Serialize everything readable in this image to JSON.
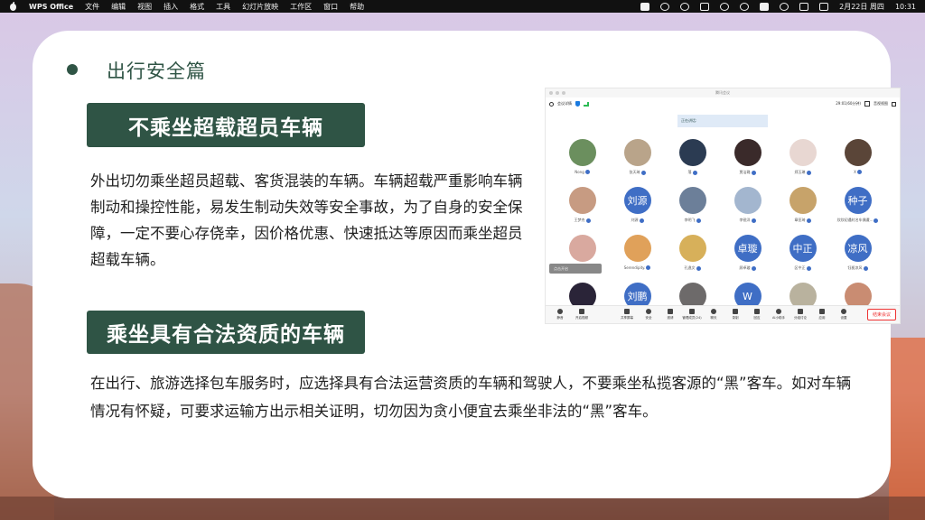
{
  "menubar": {
    "app": "WPS Office",
    "items": [
      "文件",
      "编辑",
      "视图",
      "插入",
      "格式",
      "工具",
      "幻灯片放映",
      "工作区",
      "窗口",
      "帮助"
    ],
    "date": "2月22日 周四",
    "time": "10:31"
  },
  "slide": {
    "section_title": "出行安全篇",
    "box1": "不乘坐超载超员车辆",
    "para1": "外出切勿乘坐超员超载、客货混装的车辆。车辆超载严重影响车辆制动和操控性能，易发生制动失效等安全事故，为了自身的安全保障，一定不要心存侥幸，因价格优惠、快速抵达等原因而乘坐超员超载车辆。",
    "box2": "乘坐具有合法资质的车辆",
    "para2": "在出行、旅游选择包车服务时，应选择具有合法运营资质的车辆和驾驶人，不要乘坐私揽客源的“黑”客车。如对车辆情况有怀疑，可要求运输方出示相关证明，切勿因为贪小便宜去乘坐非法的“黑”客车。"
  },
  "meeting": {
    "title": "腾讯会议",
    "info_label": "会议详情",
    "timer": "29:01(60分钟)",
    "view_label": "音视视图",
    "speaking_label": "正在讲话:",
    "tip": "点击开启",
    "participants": [
      {
        "name": "Nong",
        "avatar": "",
        "color": "#6b8f5e"
      },
      {
        "name": "张天琦",
        "avatar": "",
        "color": "#b9a48a"
      },
      {
        "name": "落",
        "avatar": "",
        "color": "#2b3b52"
      },
      {
        "name": "贾洁璐",
        "avatar": "",
        "color": "#3a2a2a"
      },
      {
        "name": "郑玉琳",
        "avatar": "",
        "color": "#e8d7d2"
      },
      {
        "name": "X",
        "avatar": "",
        "color": "#5a4538"
      },
      {
        "name": "王梦杰",
        "avatar": "",
        "color": "#c79b82"
      },
      {
        "name": "刘源",
        "avatar": "刘源",
        "color": "#3f6ec5"
      },
      {
        "name": "李明飞",
        "avatar": "",
        "color": "#6c7f99"
      },
      {
        "name": "李锐洋",
        "avatar": "",
        "color": "#a3b6cf"
      },
      {
        "name": "章亚琦",
        "avatar": "",
        "color": "#c7a36a"
      },
      {
        "name": "欣欣初遇纣名车偶遭...",
        "avatar": "种子",
        "color": "#3f6ec5"
      },
      {
        "name": "",
        "avatar": "",
        "color": "#d9a99f"
      },
      {
        "name": "Serendipity.",
        "avatar": "",
        "color": "#e0a15a"
      },
      {
        "name": "孔逸文",
        "avatar": "",
        "color": "#d7b05a"
      },
      {
        "name": "顾卓璇",
        "avatar": "卓璇",
        "color": "#3f6ec5"
      },
      {
        "name": "区中正",
        "avatar": "中正",
        "color": "#3f6ec5"
      },
      {
        "name": "钰栀凉风",
        "avatar": "凉风",
        "color": "#3f6ec5"
      },
      {
        "name": "",
        "avatar": "",
        "color": "#2a2438"
      },
      {
        "name": "",
        "avatar": "刘鹏",
        "color": "#3f6ec5"
      },
      {
        "name": "",
        "avatar": "",
        "color": "#6d6a6a"
      },
      {
        "name": "",
        "avatar": "W",
        "color": "#3f6ec5"
      },
      {
        "name": "",
        "avatar": "",
        "color": "#b9b29e"
      },
      {
        "name": "",
        "avatar": "",
        "color": "#c98c72"
      }
    ],
    "toolbar": [
      "静音",
      "开启视频",
      "共享屏幕",
      "安全",
      "邀请",
      "管理成员(24)",
      "聊天",
      "录制",
      "回应",
      "AI小助手",
      "分组讨论",
      "应用",
      "设置"
    ],
    "end_label": "结束会议"
  }
}
